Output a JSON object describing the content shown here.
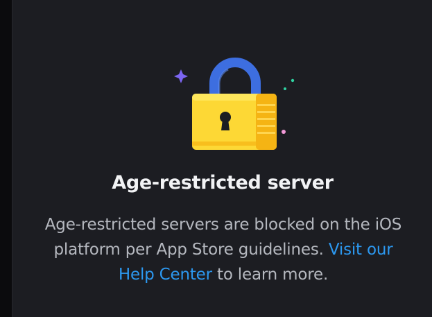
{
  "colors": {
    "page_background": "#0b0b0d",
    "panel_background": "#1c1d22",
    "title_text": "#f2f3f5",
    "body_text": "#b5b8bf",
    "link": "#2c98f0",
    "lock_body": "#fdd835",
    "lock_shackle": "#3d6ee0"
  },
  "illustration": {
    "icon": "padlock-icon",
    "sparkles": [
      "sparkle-star-icon",
      "sparkle-dot-icon"
    ]
  },
  "message": {
    "title": "Age-restricted server",
    "body": "Age-restricted servers are blocked on the iOS platform per App Store guidelines.",
    "link_text": "Visit our Help Center",
    "trailing": "to learn more."
  }
}
